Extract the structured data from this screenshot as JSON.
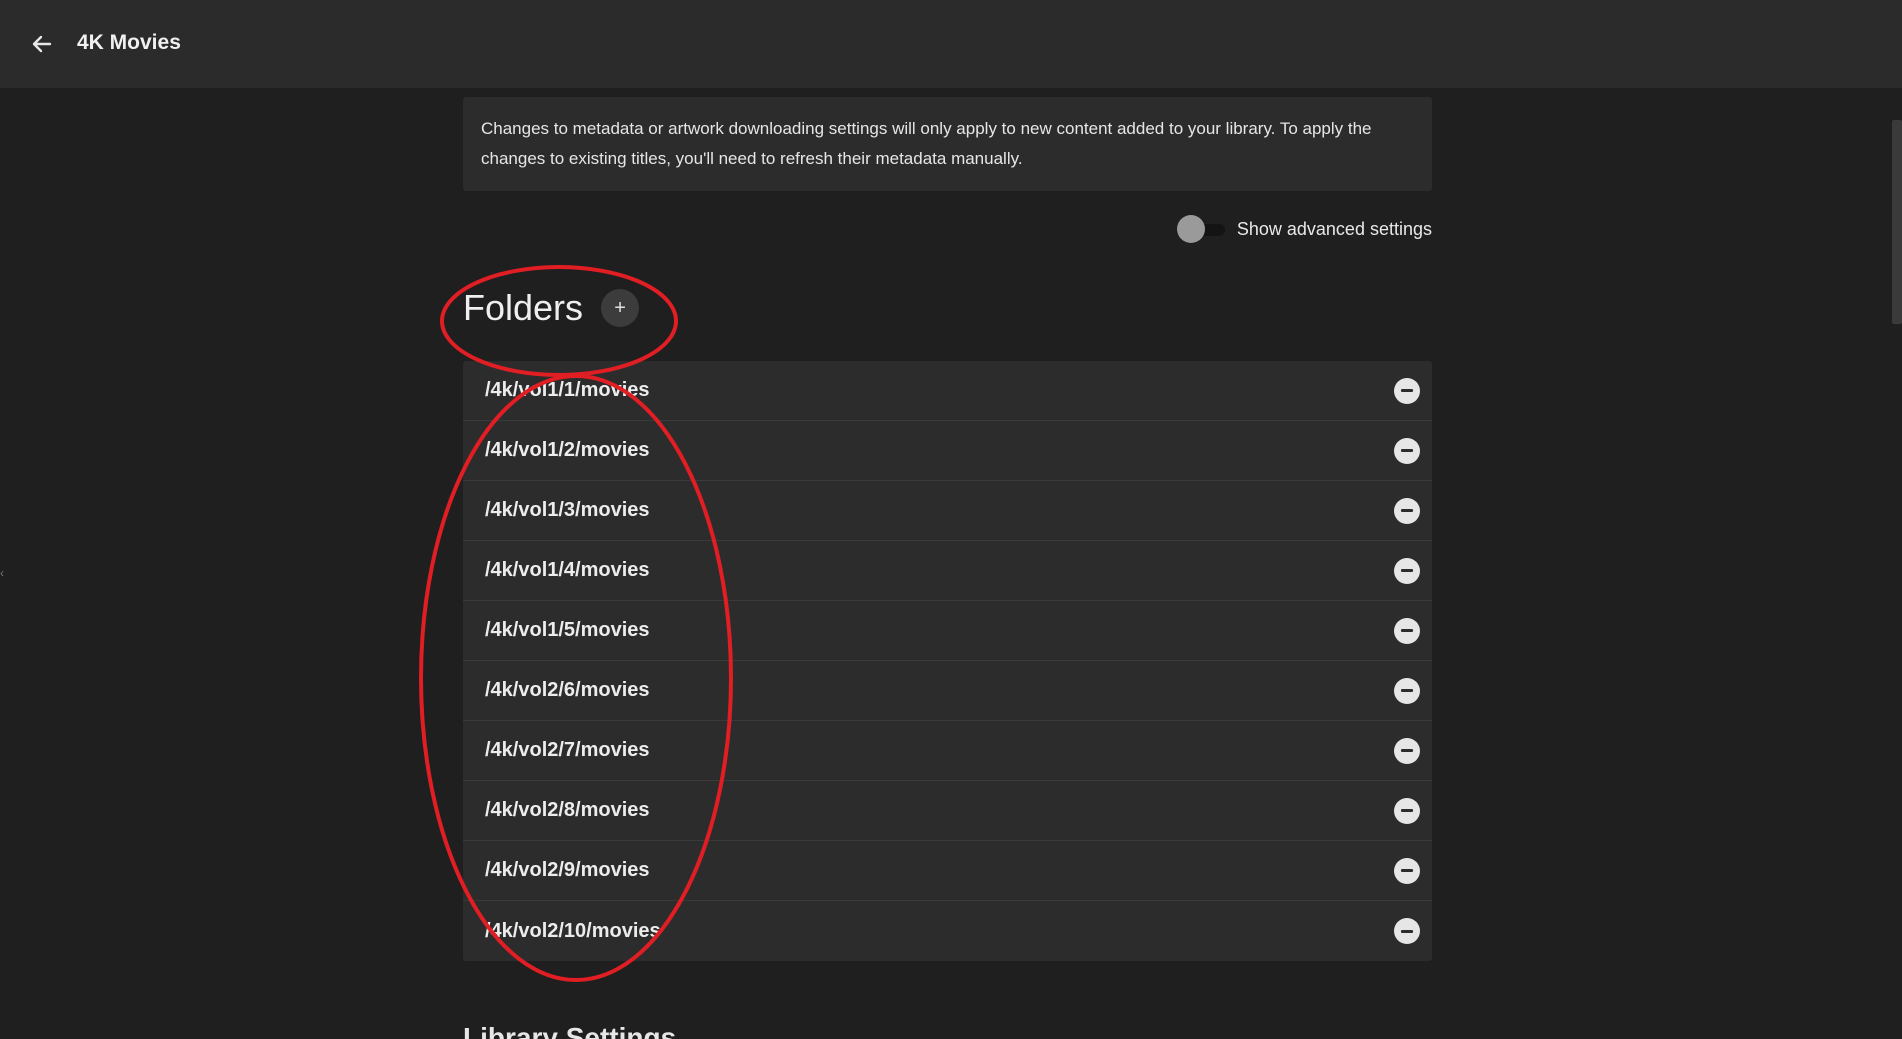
{
  "header": {
    "back_icon": "arrow-left-icon",
    "title": "4K Movies"
  },
  "notice": {
    "text": "Changes to metadata or artwork downloading settings will only apply to new content added to your library. To apply the changes to existing titles, you'll need to refresh their metadata manually."
  },
  "advanced": {
    "label": "Show advanced settings",
    "enabled": false
  },
  "folders": {
    "title": "Folders",
    "add_label": "+",
    "items": [
      {
        "path": "/4k/vol1/1/movies"
      },
      {
        "path": "/4k/vol1/2/movies"
      },
      {
        "path": "/4k/vol1/3/movies"
      },
      {
        "path": "/4k/vol1/4/movies"
      },
      {
        "path": "/4k/vol1/5/movies"
      },
      {
        "path": "/4k/vol2/6/movies"
      },
      {
        "path": "/4k/vol2/7/movies"
      },
      {
        "path": "/4k/vol2/8/movies"
      },
      {
        "path": "/4k/vol2/9/movies"
      },
      {
        "path": "/4k/vol2/10/movies"
      }
    ]
  },
  "next_section": {
    "title": "Library Settings"
  },
  "colors": {
    "background": "#1f1f1f",
    "header": "#2b2b2b",
    "panel": "#2c2c2c",
    "annotation": "#e01e24"
  }
}
